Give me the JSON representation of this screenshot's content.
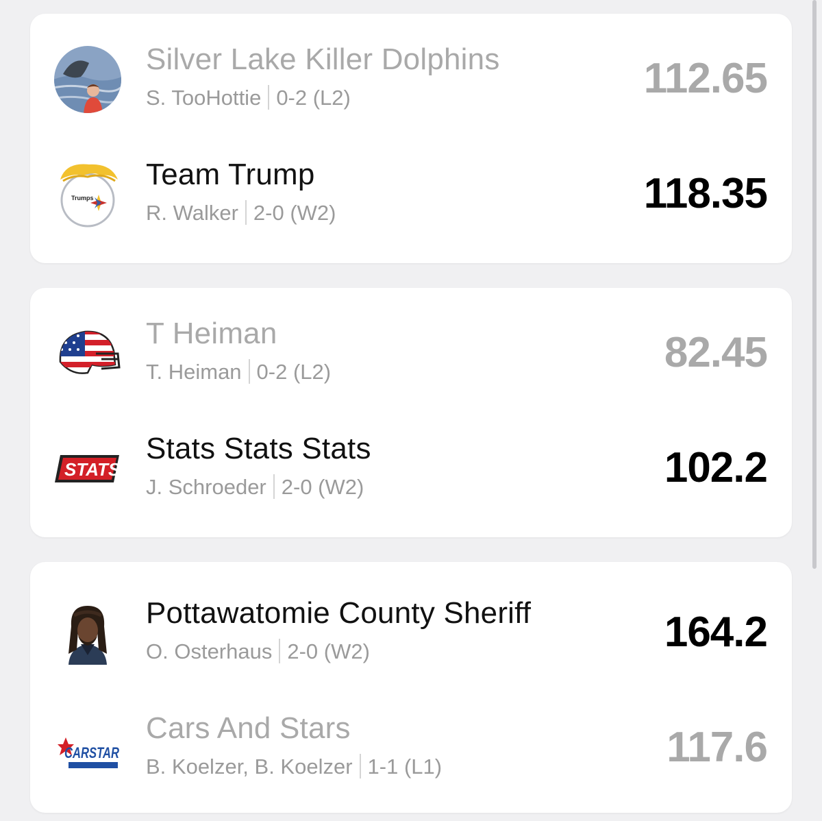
{
  "matchups": [
    {
      "teams": [
        {
          "name": "Silver Lake Killer Dolphins",
          "owner": "S. TooHottie",
          "record": "0-2 (L2)",
          "score": "112.65",
          "result": "loser",
          "logo_icon": "dolphin-photo-icon"
        },
        {
          "name": "Team Trump",
          "owner": "R. Walker",
          "record": "2-0 (W2)",
          "score": "118.35",
          "result": "winner",
          "logo_icon": "trumps-steelers-logo-icon",
          "logo_text": "Trumps"
        }
      ]
    },
    {
      "teams": [
        {
          "name": "T Heiman",
          "owner": "T. Heiman",
          "record": "0-2 (L2)",
          "score": "82.45",
          "result": "loser",
          "logo_icon": "usa-flag-helmet-icon"
        },
        {
          "name": "Stats Stats Stats",
          "owner": "J. Schroeder",
          "record": "2-0 (W2)",
          "score": "102.2",
          "result": "winner",
          "logo_icon": "stats-logo-icon",
          "logo_text": "STATS"
        }
      ]
    },
    {
      "teams": [
        {
          "name": "Pottawatomie County Sheriff",
          "owner": "O. Osterhaus",
          "record": "2-0 (W2)",
          "score": "164.2",
          "result": "winner",
          "logo_icon": "player-portrait-icon"
        },
        {
          "name": "Cars And Stars",
          "owner": "B. Koelzer, B. Koelzer",
          "record": "1-1 (L1)",
          "score": "117.6",
          "result": "loser",
          "logo_icon": "carstar-logo-icon",
          "logo_text": "CARSTAR"
        }
      ]
    }
  ],
  "colors": {
    "winner_text": "#111111",
    "loser_text": "#a9a9a9",
    "meta_text": "#9a9a9a",
    "card_bg": "#ffffff",
    "page_bg": "#f0f0f2"
  }
}
